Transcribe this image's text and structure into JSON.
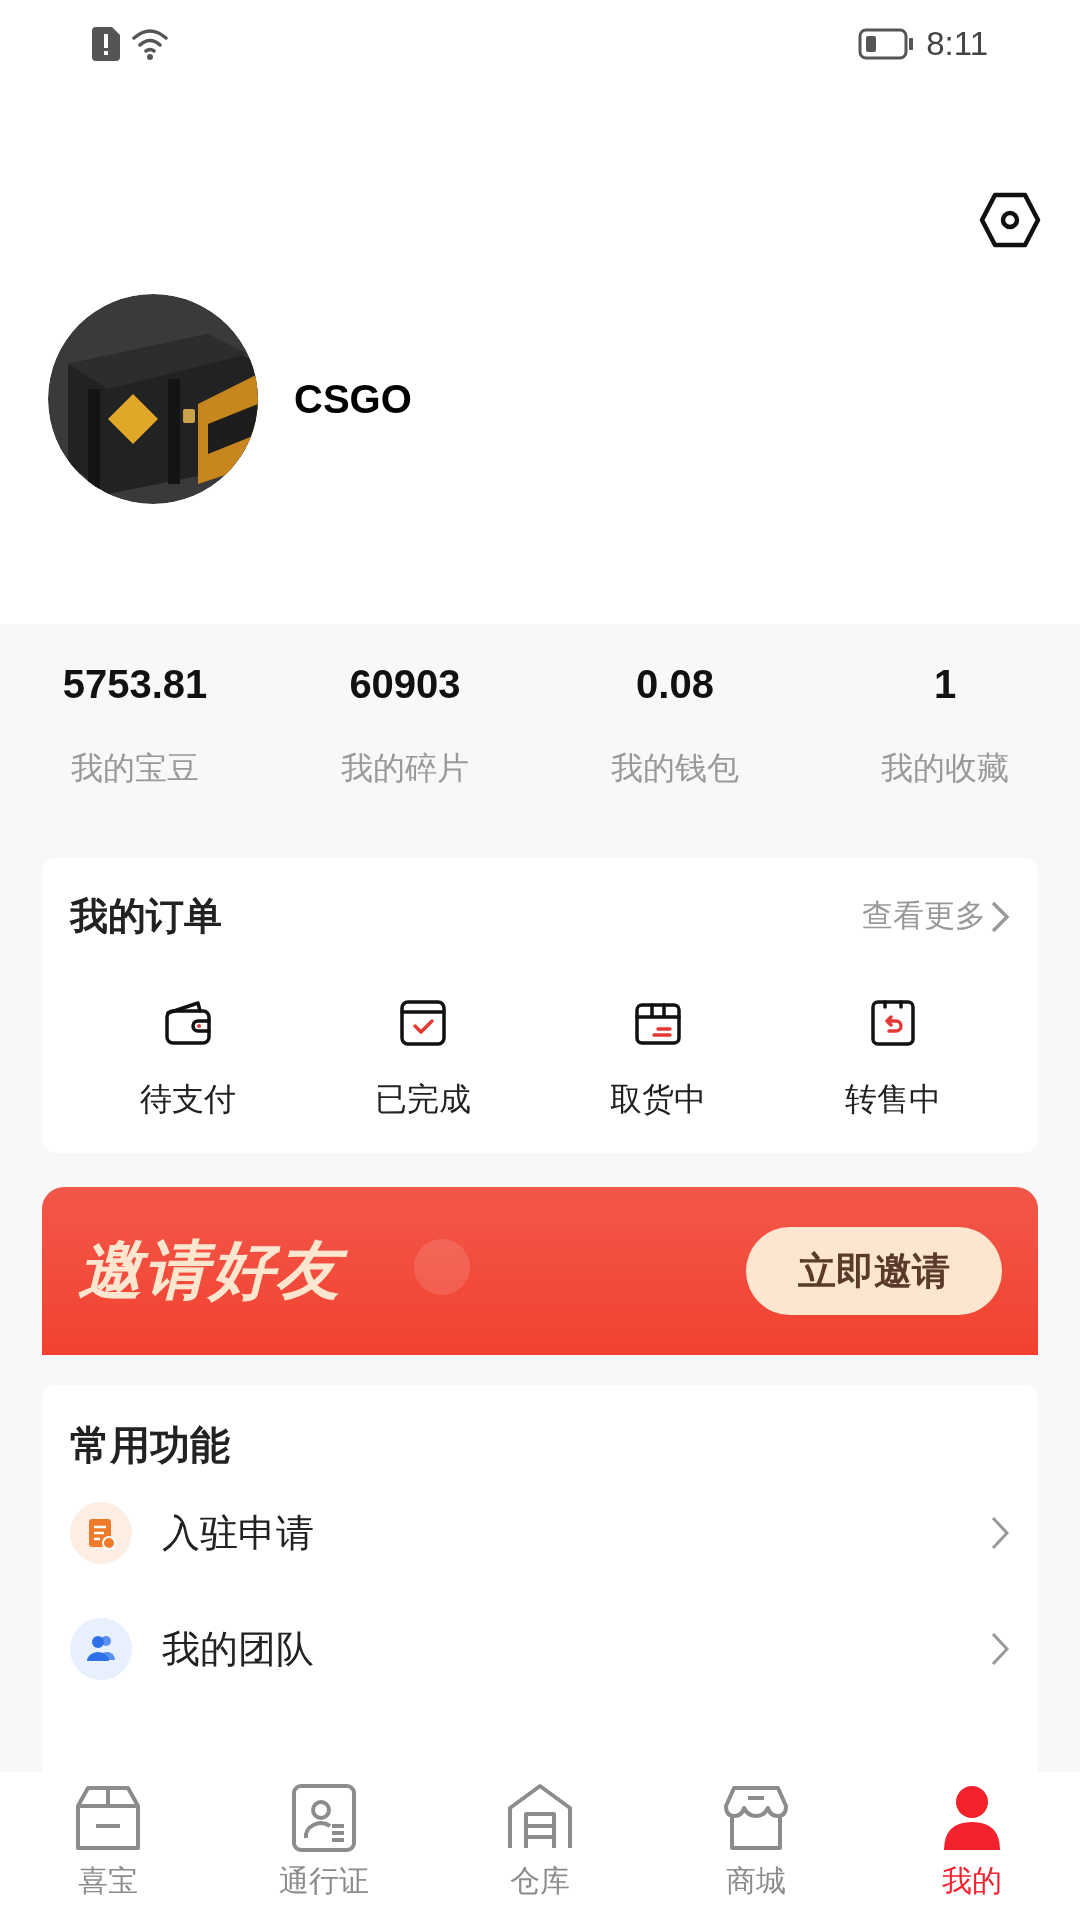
{
  "status_bar": {
    "time": "8:11"
  },
  "profile": {
    "name": "CSGO"
  },
  "stats": [
    {
      "value": "5753.81",
      "label": "我的宝豆"
    },
    {
      "value": "60903",
      "label": "我的碎片"
    },
    {
      "value": "0.08",
      "label": "我的钱包"
    },
    {
      "value": "1",
      "label": "我的收藏"
    }
  ],
  "orders": {
    "title": "我的订单",
    "more": "查看更多",
    "items": [
      {
        "kind": "wallet",
        "label": "待支付"
      },
      {
        "kind": "done",
        "label": "已完成"
      },
      {
        "kind": "box",
        "label": "取货中"
      },
      {
        "kind": "resale",
        "label": "转售中"
      }
    ]
  },
  "invite_banner": {
    "title": "邀请好友",
    "button": "立即邀请"
  },
  "functions": {
    "title": "常用功能",
    "items": [
      {
        "kind": "apply",
        "label": "入驻申请"
      },
      {
        "kind": "team",
        "label": "我的团队"
      }
    ]
  },
  "nav": [
    {
      "kind": "box",
      "label": "喜宝",
      "selected": false
    },
    {
      "kind": "pass",
      "label": "通行证",
      "selected": false
    },
    {
      "kind": "warehouse",
      "label": "仓库",
      "selected": false
    },
    {
      "kind": "store",
      "label": "商城",
      "selected": false
    },
    {
      "kind": "me",
      "label": "我的",
      "selected": true
    }
  ]
}
